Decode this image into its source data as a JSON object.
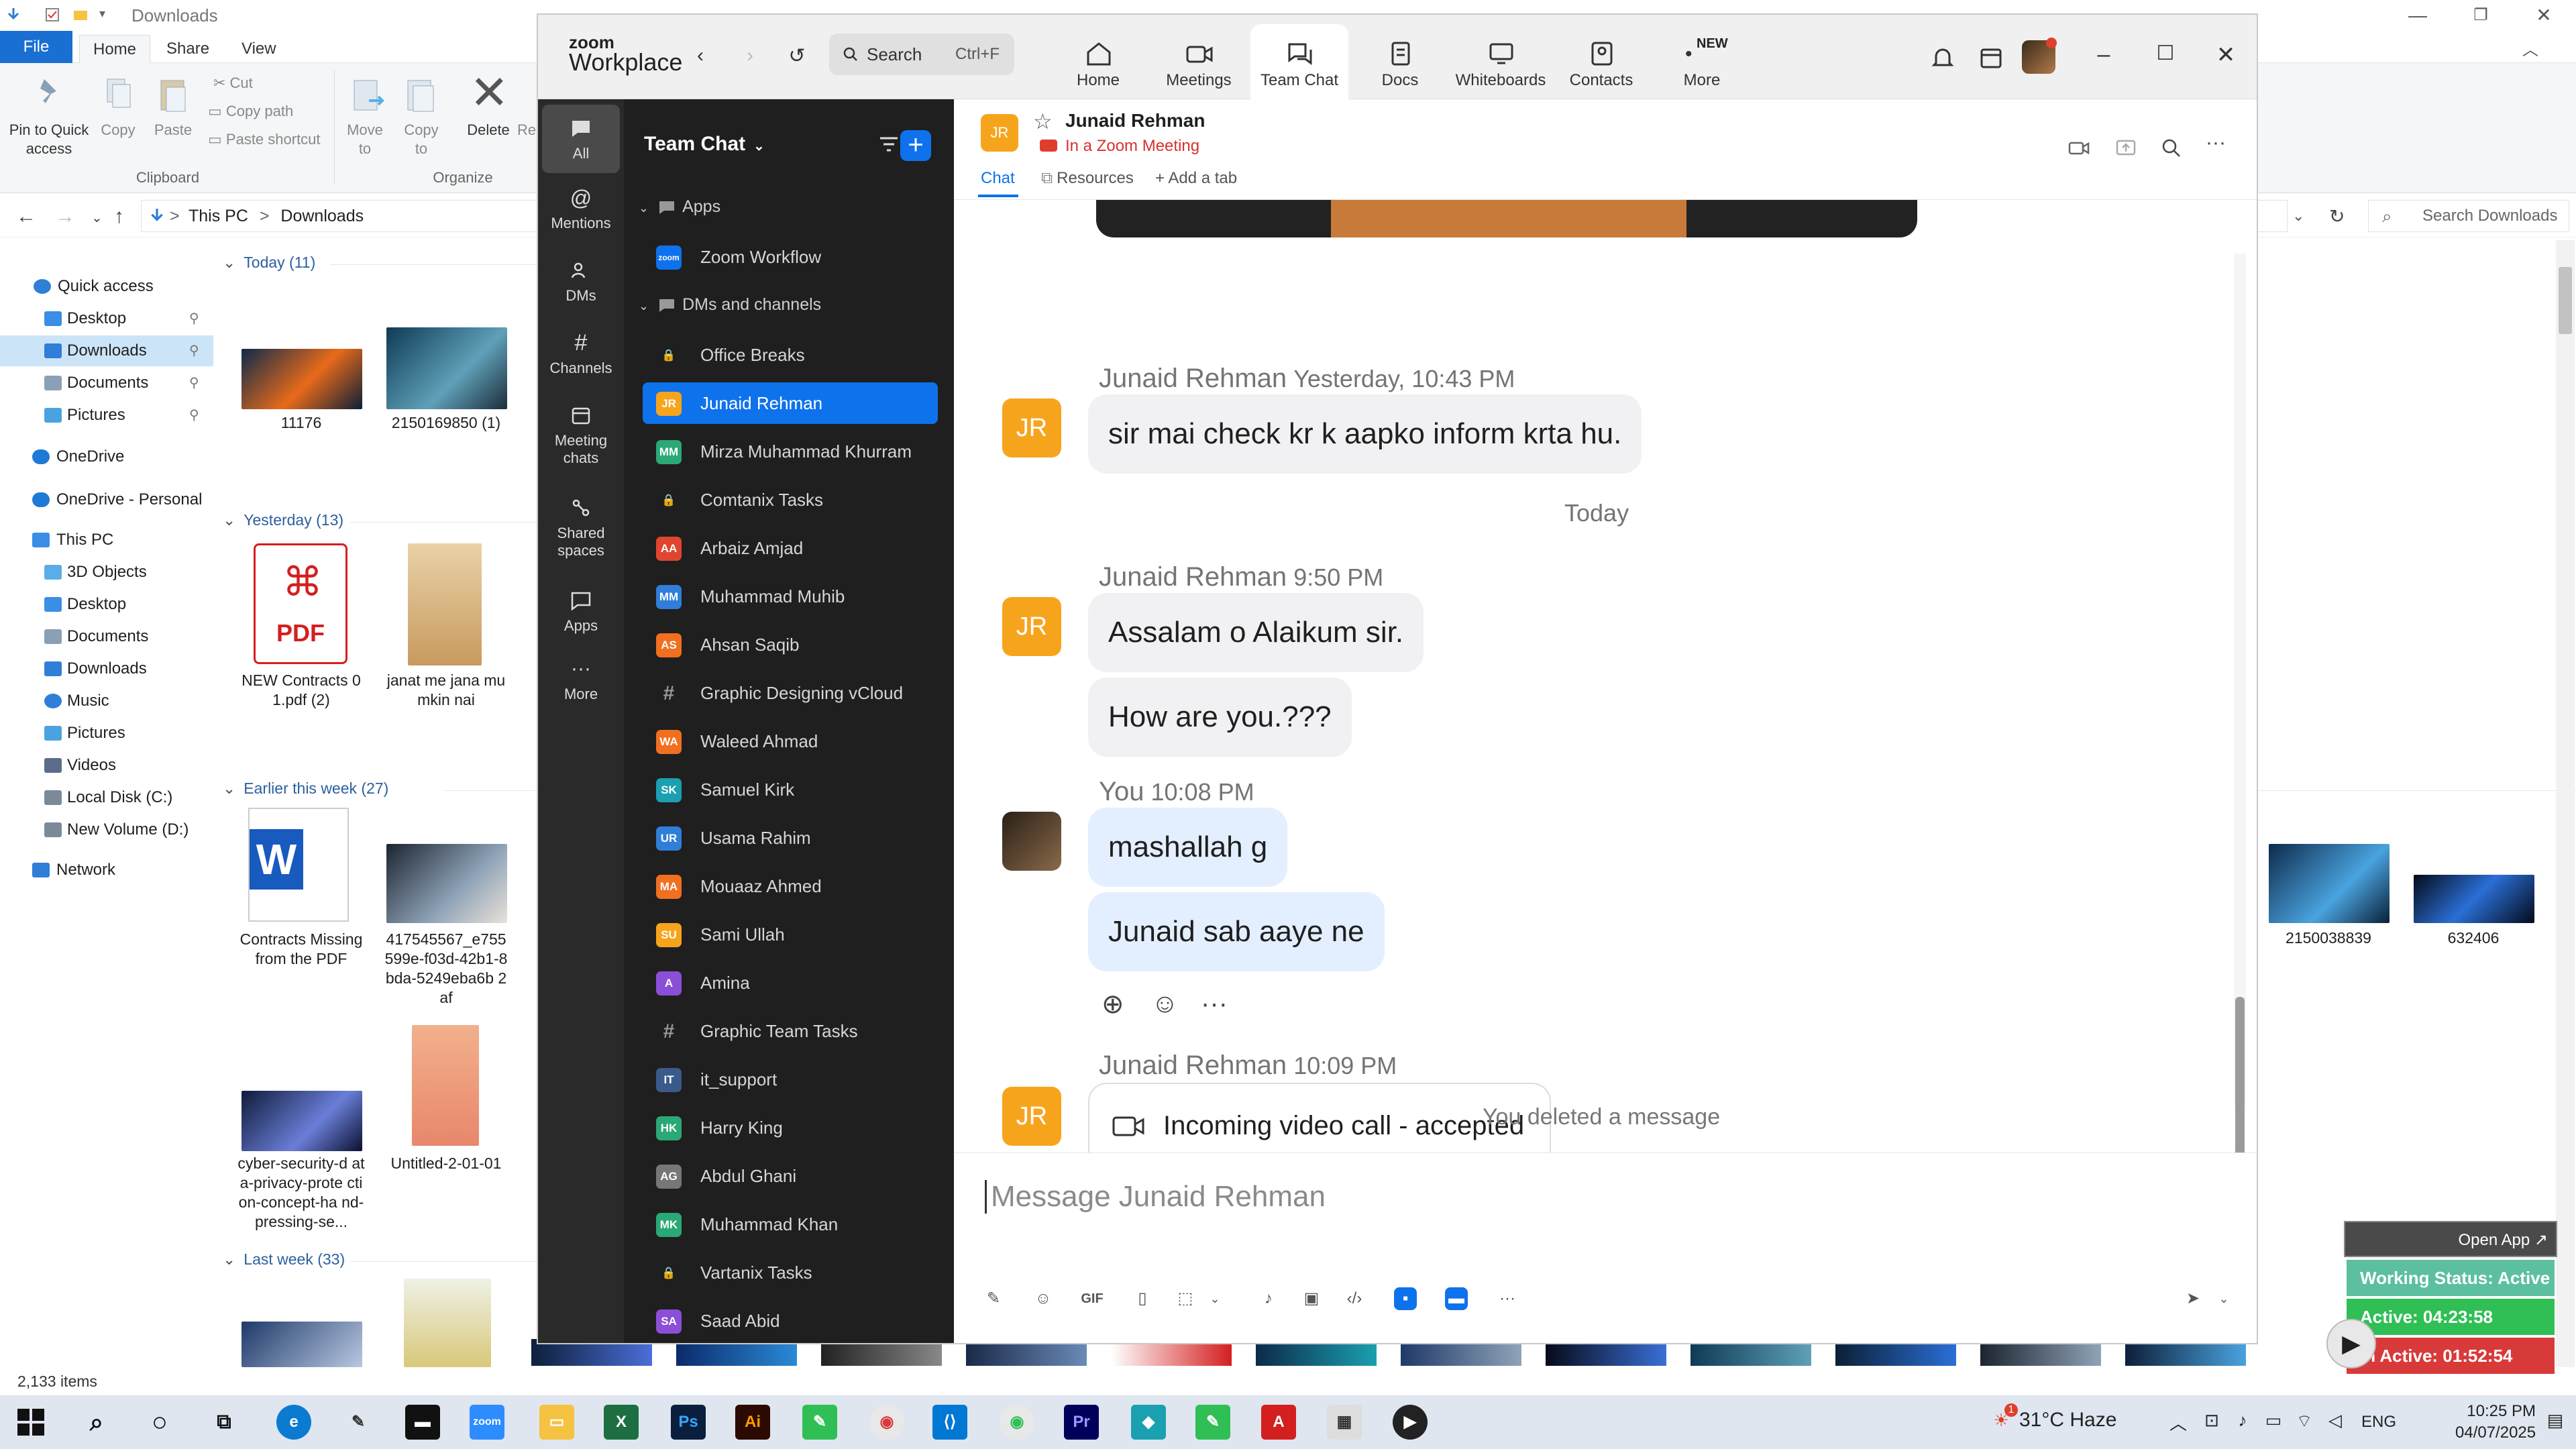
{
  "explorer": {
    "title": "Downloads",
    "tabs": [
      "File",
      "Home",
      "Share",
      "View"
    ],
    "ribbon": {
      "pin": "Pin to Quick access",
      "copy": "Copy",
      "paste": "Paste",
      "cut": "Cut",
      "copy_path": "Copy path",
      "paste_shortcut": "Paste shortcut",
      "move_to": "Move to",
      "copy_to": "Copy to",
      "delete": "Delete",
      "rename": "Re",
      "group_clipboard": "Clipboard",
      "group_organize": "Organize"
    },
    "address": {
      "this_pc": "This PC",
      "sep": ">",
      "downloads": "Downloads"
    },
    "search_placeholder": "Search Downloads",
    "nav": [
      {
        "label": "Quick access",
        "color": "#2f7ed8"
      },
      {
        "label": "Desktop",
        "color": "#3a8ee6",
        "pinned": true
      },
      {
        "label": "Downloads",
        "color": "#2f7ed8",
        "pinned": true,
        "selected": true
      },
      {
        "label": "Documents",
        "color": "#8aa0b5",
        "pinned": true
      },
      {
        "label": "Pictures",
        "color": "#4aa3df",
        "pinned": true
      },
      {
        "label": "OneDrive",
        "color": "#1e7ad6"
      },
      {
        "label": "OneDrive - Personal",
        "color": "#1e7ad6"
      },
      {
        "label": "This PC",
        "color": "#3a8ee6"
      },
      {
        "label": "3D Objects",
        "color": "#5aaee8"
      },
      {
        "label": "Desktop",
        "color": "#3a8ee6"
      },
      {
        "label": "Documents",
        "color": "#8aa0b5"
      },
      {
        "label": "Downloads",
        "color": "#2f7ed8"
      },
      {
        "label": "Music",
        "color": "#2f7ed8"
      },
      {
        "label": "Pictures",
        "color": "#4aa3df"
      },
      {
        "label": "Videos",
        "color": "#5b6d8a"
      },
      {
        "label": "Local Disk (C:)",
        "color": "#7a8a99"
      },
      {
        "label": "New Volume (D:)",
        "color": "#7a8a99"
      },
      {
        "label": "Network",
        "color": "#2f7ed8"
      }
    ],
    "sections": {
      "today": "Today (11)",
      "yesterday": "Yesterday (13)",
      "earlier": "Earlier this week (27)",
      "last_week": "Last week (33)"
    },
    "files": {
      "f1": "11176",
      "f2": "2150169850 (1)",
      "f3": "NEW Contracts 01.pdf (2)",
      "f4": "janat me jana mumkin nai",
      "f5": "Contracts Missing from the PDF",
      "f6": "417545567_e755 599e-f03d-42b1-8bda-5249eba6b 2af",
      "f7": "cyber-security-d ata-privacy-prote ction-concept-ha nd-pressing-se...",
      "f8": "Untitled-2-01-01",
      "f9": "2150038839",
      "f10": "632406",
      "pdf_label": "PDF"
    },
    "status": "2,133 items"
  },
  "zoom": {
    "brand_top": "zoom",
    "brand_bottom": "Workplace",
    "search": {
      "label": "Search",
      "shortcut": "Ctrl+F"
    },
    "tabs": [
      "Home",
      "Meetings",
      "Team Chat",
      "Docs",
      "Whiteboards",
      "Contacts",
      "More"
    ],
    "new_badge": "NEW",
    "rail": [
      "All",
      "Mentions",
      "DMs",
      "Channels",
      "Meeting chats",
      "Shared spaces",
      "Apps",
      "More"
    ],
    "list": {
      "title": "Team Chat",
      "apps_header": "Apps",
      "zoom_workflow": "Zoom Workflow",
      "dms_header": "DMs and channels",
      "items": [
        {
          "label": "Office Breaks",
          "kind": "lock"
        },
        {
          "label": "Junaid Rehman",
          "kind": "av",
          "initials": "JR",
          "color": "#f7a41d",
          "selected": true
        },
        {
          "label": "Mirza Muhammad Khurram",
          "kind": "av",
          "initials": "MM",
          "color": "#2aa876"
        },
        {
          "label": "Comtanix Tasks",
          "kind": "lock"
        },
        {
          "label": "Arbaiz Amjad",
          "kind": "av",
          "initials": "AA",
          "color": "#e0452f"
        },
        {
          "label": "Muhammad Muhib",
          "kind": "av",
          "initials": "MM",
          "color": "#2f7ed8"
        },
        {
          "label": "Ahsan Saqib",
          "kind": "av",
          "initials": "AS",
          "color": "#f07020"
        },
        {
          "label": "Graphic Designing vCloud",
          "kind": "hash"
        },
        {
          "label": "Waleed Ahmad",
          "kind": "av",
          "initials": "WA",
          "color": "#f07020"
        },
        {
          "label": "Samuel Kirk",
          "kind": "av",
          "initials": "SK",
          "color": "#1aa0b0"
        },
        {
          "label": "Usama Rahim",
          "kind": "av",
          "initials": "UR",
          "color": "#2f7ed8"
        },
        {
          "label": "Mouaaz Ahmed",
          "kind": "av",
          "initials": "MA",
          "color": "#f07020"
        },
        {
          "label": "Sami Ullah",
          "kind": "av",
          "initials": "SU",
          "color": "#f7a41d"
        },
        {
          "label": "Amina",
          "kind": "av",
          "initials": "A",
          "color": "#8a4fd6"
        },
        {
          "label": "Graphic Team Tasks",
          "kind": "hash"
        },
        {
          "label": "it_support",
          "kind": "av",
          "initials": "IT",
          "color": "#3a5a8a"
        },
        {
          "label": "Harry King",
          "kind": "av",
          "initials": "HK",
          "color": "#2aa876"
        },
        {
          "label": "Abdul Ghani",
          "kind": "av",
          "initials": "AG",
          "color": "#777777"
        },
        {
          "label": "Muhammad Khan",
          "kind": "av",
          "initials": "MK",
          "color": "#2aa876"
        },
        {
          "label": "Vartanix Tasks",
          "kind": "lock"
        },
        {
          "label": "Saad Abid",
          "kind": "av",
          "initials": "SA",
          "color": "#8a4fd6"
        }
      ]
    },
    "chat": {
      "name": "Junaid Rehman",
      "initials": "JR",
      "status": "In a Zoom Meeting",
      "tabs": {
        "chat": "Chat",
        "resources": "Resources",
        "add": "+ Add a tab"
      },
      "msg1_name": "Junaid Rehman",
      "msg1_time": "Yesterday, 10:43 PM",
      "msg1_text": "sir mai check kr k aapko inform krta hu.",
      "today": "Today",
      "msg2_name": "Junaid Rehman",
      "msg2_time": "9:50 PM",
      "msg2_text_a": "Assalam o Alaikum sir.",
      "msg2_text_b": "How are you.???",
      "msg3_name": "You",
      "msg3_time": "10:08 PM",
      "msg3_text_a": "mashallah g",
      "msg3_text_b": "Junaid sab aaye ne",
      "msg4_name": "Junaid Rehman",
      "msg4_time": "10:09 PM",
      "msg4_call": "Incoming video call - accepted",
      "deleted": "You deleted a message",
      "composer_placeholder": "Message Junaid Rehman",
      "gif": "GIF"
    }
  },
  "tracker": {
    "open_app": "Open App ↗",
    "working": "Working Status: Active",
    "active": "Active: 04:23:58",
    "inactive": "In Active: 01:52:54"
  },
  "taskbar": {
    "weather": "31°C  Haze",
    "weather_badge": "1",
    "lang": "ENG",
    "time": "10:25 PM",
    "date": "04/07/2025"
  }
}
